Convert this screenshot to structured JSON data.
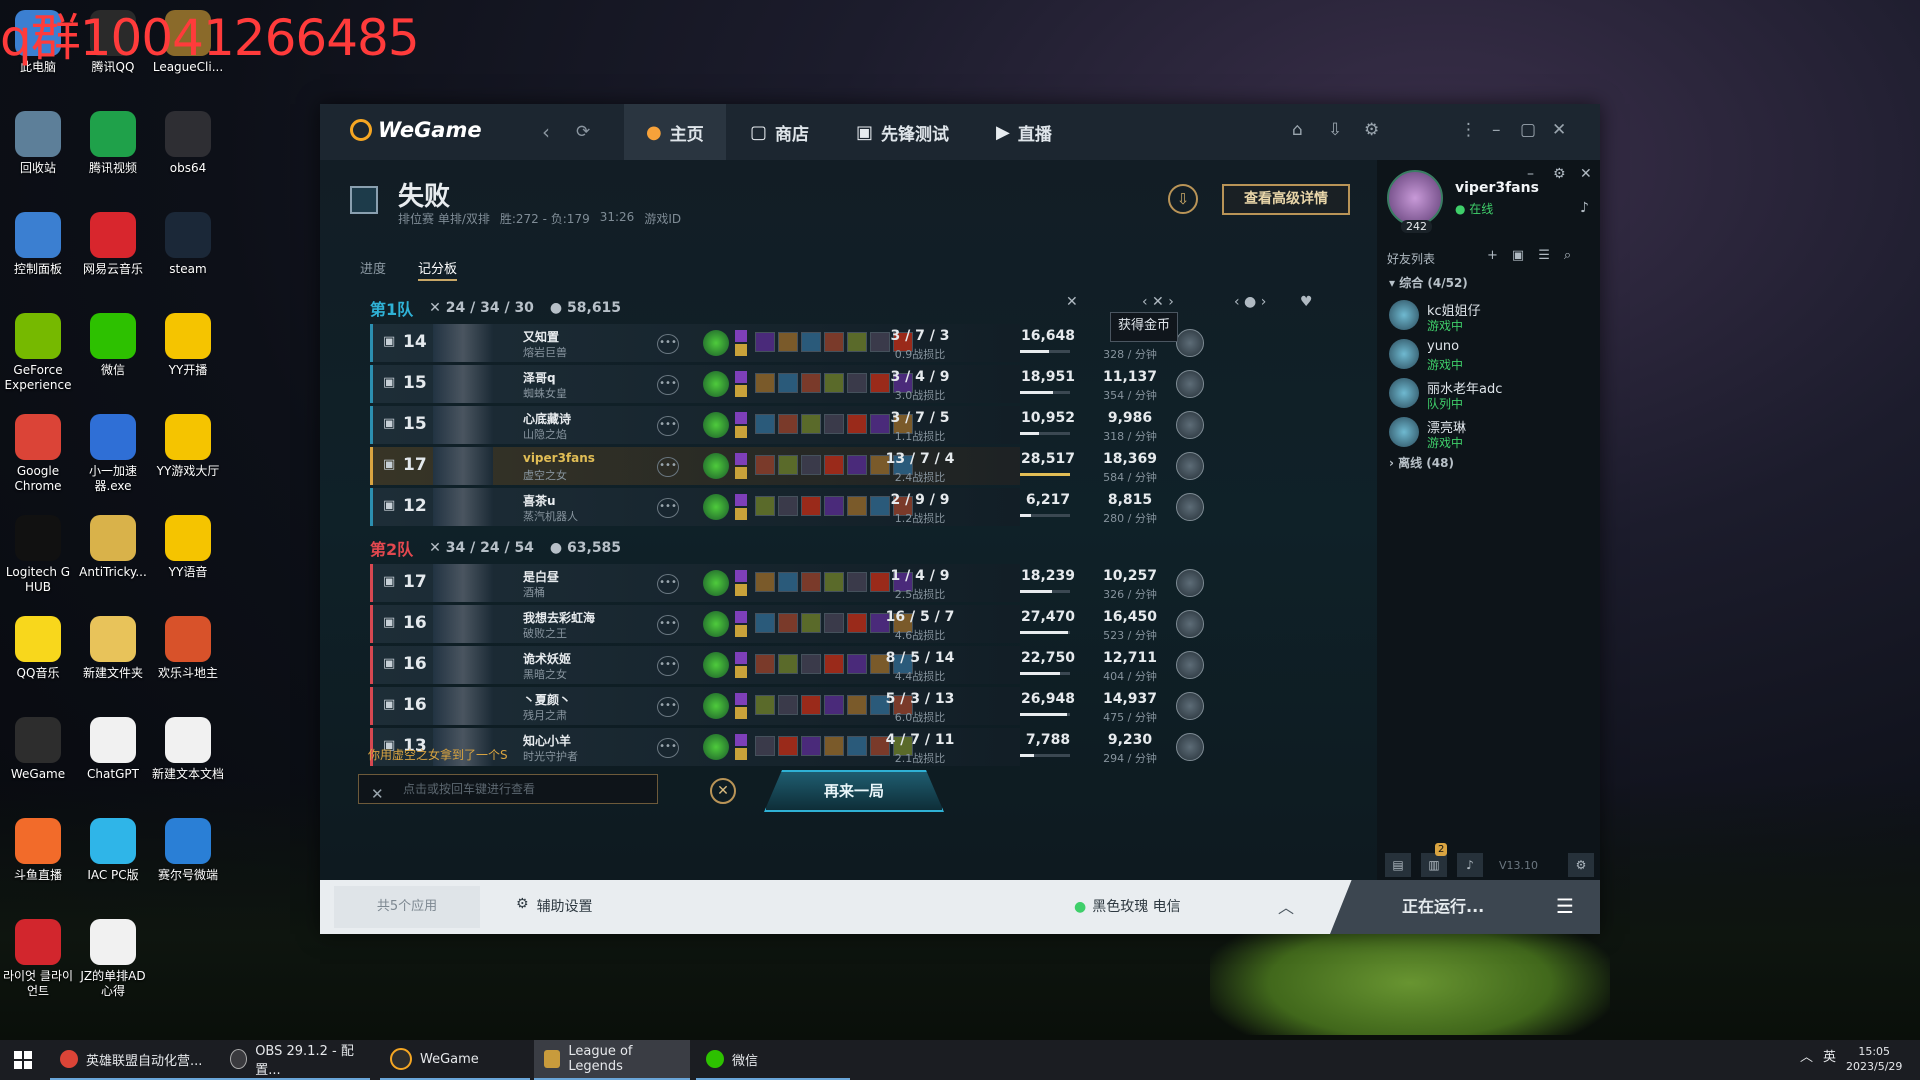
{
  "watermark": "q群10041266485",
  "desktop": {
    "icons": [
      {
        "label": "此电脑",
        "color": "#3b7fd1"
      },
      {
        "label": "腾讯QQ",
        "color": "#2a2a2a"
      },
      {
        "label": "LeagueCli...",
        "color": "#8a6a2a"
      },
      {
        "label": "回收站",
        "color": "#5d7f99"
      },
      {
        "label": "腾讯视频",
        "color": "#1fa14a"
      },
      {
        "label": "obs64",
        "color": "#2e2e33"
      },
      {
        "label": "控制面板",
        "color": "#3b7fd1"
      },
      {
        "label": "网易云音乐",
        "color": "#d8262d"
      },
      {
        "label": "steam",
        "color": "#1b2838"
      },
      {
        "label": "GeForce Experience",
        "color": "#76b900"
      },
      {
        "label": "微信",
        "color": "#2dc100"
      },
      {
        "label": "YY开播",
        "color": "#f5c400"
      },
      {
        "label": "Google Chrome",
        "color": "#db4437"
      },
      {
        "label": "小一加速器.exe",
        "color": "#2f6fd6"
      },
      {
        "label": "YY游戏大厅",
        "color": "#f5c400"
      },
      {
        "label": "Logitech G HUB",
        "color": "#111111"
      },
      {
        "label": "AntiTricky...",
        "color": "#d9b24a"
      },
      {
        "label": "YY语音",
        "color": "#f5c400"
      },
      {
        "label": "QQ音乐",
        "color": "#f8d71c"
      },
      {
        "label": "新建文件夹",
        "color": "#e8c35a"
      },
      {
        "label": "欢乐斗地主",
        "color": "#d8522a"
      },
      {
        "label": "WeGame",
        "color": "#2d2d2d"
      },
      {
        "label": "ChatGPT",
        "color": "#f1f1f1"
      },
      {
        "label": "新建文本文档",
        "color": "#f1f1f1"
      },
      {
        "label": "斗鱼直播",
        "color": "#f26b2a"
      },
      {
        "label": "IAC PC版",
        "color": "#2fb5e8"
      },
      {
        "label": "赛尔号微端",
        "color": "#2a7fd6"
      },
      {
        "label": "라이엇 클라이언트",
        "color": "#d2262d"
      },
      {
        "label": "JZ的单排AD心得",
        "color": "#f1f1f1"
      }
    ]
  },
  "wegame": {
    "logo": "WeGame",
    "tabs": [
      {
        "label": "主页",
        "icon": "home-icon",
        "active": true
      },
      {
        "label": "商店",
        "icon": "bag-icon",
        "active": false
      },
      {
        "label": "先锋测试",
        "icon": "gamepad-icon",
        "active": false
      },
      {
        "label": "直播",
        "icon": "play-icon",
        "active": false
      }
    ]
  },
  "match": {
    "result": "失败",
    "queue": "排位赛 单排/双排",
    "record": "胜:272 - 负:179",
    "duration": "31:26",
    "game_id_label": "游戏ID",
    "advanced_button": "查看高级详情",
    "subtabs": [
      "进度",
      "记分板"
    ],
    "tooltip": "获得金币",
    "teams": [
      {
        "name": "第1队",
        "kda": "24 / 34 / 30",
        "gold": "58,615",
        "players": [
          {
            "level": "14",
            "name": "又知置",
            "champ": "熔岩巨兽",
            "kda": "3 / 7 / 3",
            "kda_ratio": "0.9战损比",
            "damage": "16,648",
            "damage_frac": 0.58,
            "gold": "",
            "gold_rate": "328 / 分钟"
          },
          {
            "level": "15",
            "name": "泽哥q",
            "champ": "蜘蛛女皇",
            "kda": "3 / 4 / 9",
            "kda_ratio": "3.0战损比",
            "damage": "18,951",
            "damage_frac": 0.66,
            "gold": "11,137",
            "gold_rate": "354 / 分钟"
          },
          {
            "level": "15",
            "name": "心底藏诗",
            "champ": "山隐之焰",
            "kda": "3 / 7 / 5",
            "kda_ratio": "1.1战损比",
            "damage": "10,952",
            "damage_frac": 0.38,
            "gold": "9,986",
            "gold_rate": "318 / 分钟"
          },
          {
            "level": "17",
            "name": "viper3fans",
            "champ": "虚空之女",
            "kda": "13 / 7 / 4",
            "kda_ratio": "2.4战损比",
            "damage": "28,517",
            "damage_frac": 1.0,
            "gold": "18,369",
            "gold_rate": "584 / 分钟",
            "me": true
          },
          {
            "level": "12",
            "name": "喜茶u",
            "champ": "蒸汽机器人",
            "kda": "2 / 9 / 9",
            "kda_ratio": "1.2战损比",
            "damage": "6,217",
            "damage_frac": 0.22,
            "gold": "8,815",
            "gold_rate": "280 / 分钟"
          }
        ]
      },
      {
        "name": "第2队",
        "kda": "34 / 24 / 54",
        "gold": "63,585",
        "players": [
          {
            "level": "17",
            "name": "是白昼",
            "champ": "酒桶",
            "kda": "1 / 4 / 9",
            "kda_ratio": "2.5战损比",
            "damage": "18,239",
            "damage_frac": 0.64,
            "gold": "10,257",
            "gold_rate": "326 / 分钟"
          },
          {
            "level": "16",
            "name": "我想去彩虹海",
            "champ": "破败之王",
            "kda": "16 / 5 / 7",
            "kda_ratio": "4.6战损比",
            "damage": "27,470",
            "damage_frac": 0.96,
            "gold": "16,450",
            "gold_rate": "523 / 分钟"
          },
          {
            "level": "16",
            "name": "诡术妖姬",
            "champ": "黑暗之女",
            "kda": "8 / 5 / 14",
            "kda_ratio": "4.4战损比",
            "damage": "22,750",
            "damage_frac": 0.8,
            "gold": "12,711",
            "gold_rate": "404 / 分钟"
          },
          {
            "level": "16",
            "name": "丶夏颜丶",
            "champ": "残月之肃",
            "kda": "5 / 3 / 13",
            "kda_ratio": "6.0战损比",
            "damage": "26,948",
            "damage_frac": 0.94,
            "gold": "14,937",
            "gold_rate": "475 / 分钟"
          },
          {
            "level": "13",
            "name": "知心小羊",
            "champ": "时光守护者",
            "kda": "4 / 7 / 11",
            "kda_ratio": "2.1战损比",
            "damage": "7,788",
            "damage_frac": 0.27,
            "gold": "9,230",
            "gold_rate": "294 / 分钟"
          }
        ]
      }
    ],
    "event_message": "你用虚空之女拿到了一个S",
    "chat_placeholder": "点击或按回车键进行查看",
    "play_again": "再来一局"
  },
  "friends": {
    "user": "viper3fans",
    "status": "在线",
    "level": "242",
    "list_title": "好友列表",
    "group_all": "综合 (4/52)",
    "group_offline": "离线 (48)",
    "items": [
      {
        "name": "kc姐姐仔",
        "status": "游戏中"
      },
      {
        "name": "yuno",
        "status": "游戏中"
      },
      {
        "name": "丽水老年adc",
        "status": "队列中"
      },
      {
        "name": "漂亮琳",
        "status": "游戏中"
      }
    ],
    "badge": "2",
    "version": "V13.10"
  },
  "bottom": {
    "apps": "共5个应用",
    "assist": "辅助设置",
    "server": "黑色玫瑰 电信",
    "running": "正在运行..."
  },
  "taskbar": {
    "items": [
      {
        "label": "英雄联盟自动化营...",
        "active": false
      },
      {
        "label": "OBS 29.1.2 - 配置...",
        "active": false
      },
      {
        "label": "WeGame",
        "active": false
      },
      {
        "label": "League of Legends",
        "active": true
      },
      {
        "label": "微信",
        "active": false
      }
    ],
    "ime": "英",
    "time": "15:05",
    "date": "2023/5/29"
  }
}
